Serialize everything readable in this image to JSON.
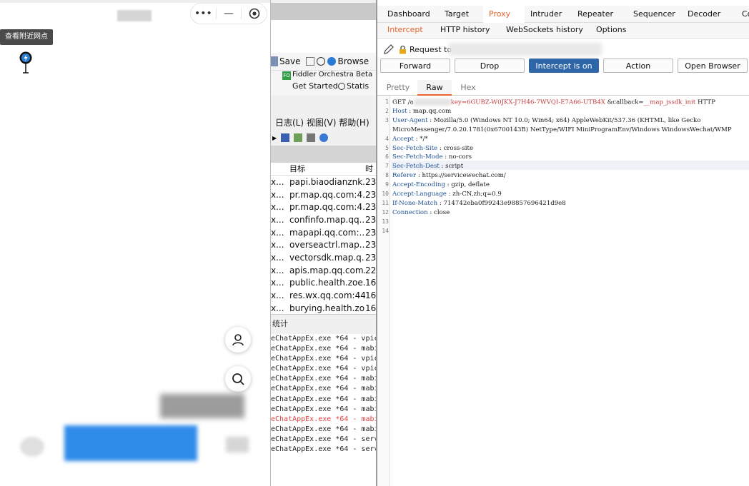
{
  "miniprogram": {
    "tooltip": "查看附近网点",
    "capsule": {
      "more": "•••",
      "minimize": "—",
      "close_icon": "target-icon"
    }
  },
  "fiddler": {
    "save": "Save",
    "browse": "Browse",
    "orchestra": "Fiddler Orchestra Beta",
    "get_started": "Get Started",
    "stats": "Statis",
    "menu": "日志(L)   视图(V)   帮助(H)",
    "list_headers": [
      "",
      "目标",
      "时"
    ],
    "rows": [
      {
        "c1": "x...",
        "host": "papi.biaodianznk...",
        "t": "23"
      },
      {
        "c1": "x...",
        "host": "pr.map.qq.com:4...",
        "t": "23"
      },
      {
        "c1": "x...",
        "host": "pr.map.qq.com:4...",
        "t": "23"
      },
      {
        "c1": "x...",
        "host": "confinfo.map.qq....",
        "t": "23"
      },
      {
        "c1": "x...",
        "host": "mapapi.qq.com:...",
        "t": "23"
      },
      {
        "c1": "x...",
        "host": "overseactrl.map....",
        "t": "23"
      },
      {
        "c1": "x...",
        "host": "vectorsdk.map.q...",
        "t": "23"
      },
      {
        "c1": "x...",
        "host": "apis.map.qq.com...",
        "t": "22"
      },
      {
        "c1": "x...",
        "host": "public.health.zoe...",
        "t": "16"
      },
      {
        "c1": "x...",
        "host": "res.wx.qq.com:443",
        "t": "16"
      },
      {
        "c1": "x...",
        "host": "burying.health.zo...",
        "t": "16"
      }
    ],
    "stats_header": "统计",
    "log": [
      {
        "text": "eChatAppEx.exe *64 - vpic",
        "red": false
      },
      {
        "text": "eChatAppEx.exe *64 - mabi",
        "red": false
      },
      {
        "text": "eChatAppEx.exe *64 - vpic",
        "red": false
      },
      {
        "text": "eChatAppEx.exe *64 - vpic",
        "red": false
      },
      {
        "text": "eChatAppEx.exe *64 - mabi",
        "red": false
      },
      {
        "text": "eChatAppEx.exe *64 - mabi",
        "red": false
      },
      {
        "text": "eChatAppEx.exe *64 - mabi",
        "red": false
      },
      {
        "text": "eChatAppEx.exe *64 - mabi",
        "red": false
      },
      {
        "text": "eChatAppEx.exe *64 - mabi",
        "red": true
      },
      {
        "text": "eChatAppEx.exe *64 - mabi",
        "red": false
      },
      {
        "text": "eChatAppEx.exe *64 - serv",
        "red": false
      },
      {
        "text": "eChatAppEx.exe *64 - serv",
        "red": false
      }
    ]
  },
  "burp": {
    "main_tabs": [
      "Dashboard",
      "Target",
      "Proxy",
      "Intruder",
      "Repeater",
      "Sequencer",
      "Decoder",
      "Co"
    ],
    "main_active": 2,
    "sub_tabs": [
      "Intercept",
      "HTTP history",
      "WebSockets history",
      "Options"
    ],
    "sub_active": 0,
    "request_label": "Request to",
    "buttons": [
      "Forward",
      "Drop",
      "Intercept is on",
      "Action",
      "Open Browser"
    ],
    "view_tabs": [
      "Pretty",
      "Raw",
      "Hex"
    ],
    "view_active": 1,
    "line1": {
      "a": "GET /a",
      "b": "key=6GUBZ-W0JKX-J7H46-7WVQI-E7A66-UTB4X",
      "c": "  &callback=",
      "d": "__map_jssdk_init",
      "e": "  HTTP"
    },
    "headers": [
      {
        "k": "Host",
        "v": "map.qq.com"
      },
      {
        "k": "User-Agent",
        "v": "Mozilla/5.0  (Windows NT 10.0; Win64; x64) AppleWebKit/537.36  (KHTML, like Gecko"
      },
      {
        "k": "",
        "v": "MicroMessenger/7.0.20.1781(0x6700143B)    NetType/WIFI  MiniProgramEnv/Windows  WindowsWechat/WMP"
      },
      {
        "k": "Accept",
        "v": "*/*"
      },
      {
        "k": "Sec-Fetch-Site",
        "v": "cross-site"
      },
      {
        "k": "Sec-Fetch-Mode",
        "v": "no-cors"
      },
      {
        "k": "Sec-Fetch-Dest",
        "v": "script"
      },
      {
        "k": "Referer",
        "v": "https://servicewechat.com/"
      },
      {
        "k": "Accept-Encoding",
        "v": "gzip, deflate"
      },
      {
        "k": "Accept-Language",
        "v": "zh-CN,zh;q=0.9"
      },
      {
        "k": "If-None-Match",
        "v": "714742eba0f99243e98857696421d9e8"
      },
      {
        "k": "Connection",
        "v": "close"
      }
    ],
    "line_numbers": [
      "1",
      "2",
      "3",
      "",
      "4",
      "5",
      "6",
      "7",
      "8",
      "9",
      "10",
      "11",
      "12",
      "13",
      "14"
    ]
  }
}
